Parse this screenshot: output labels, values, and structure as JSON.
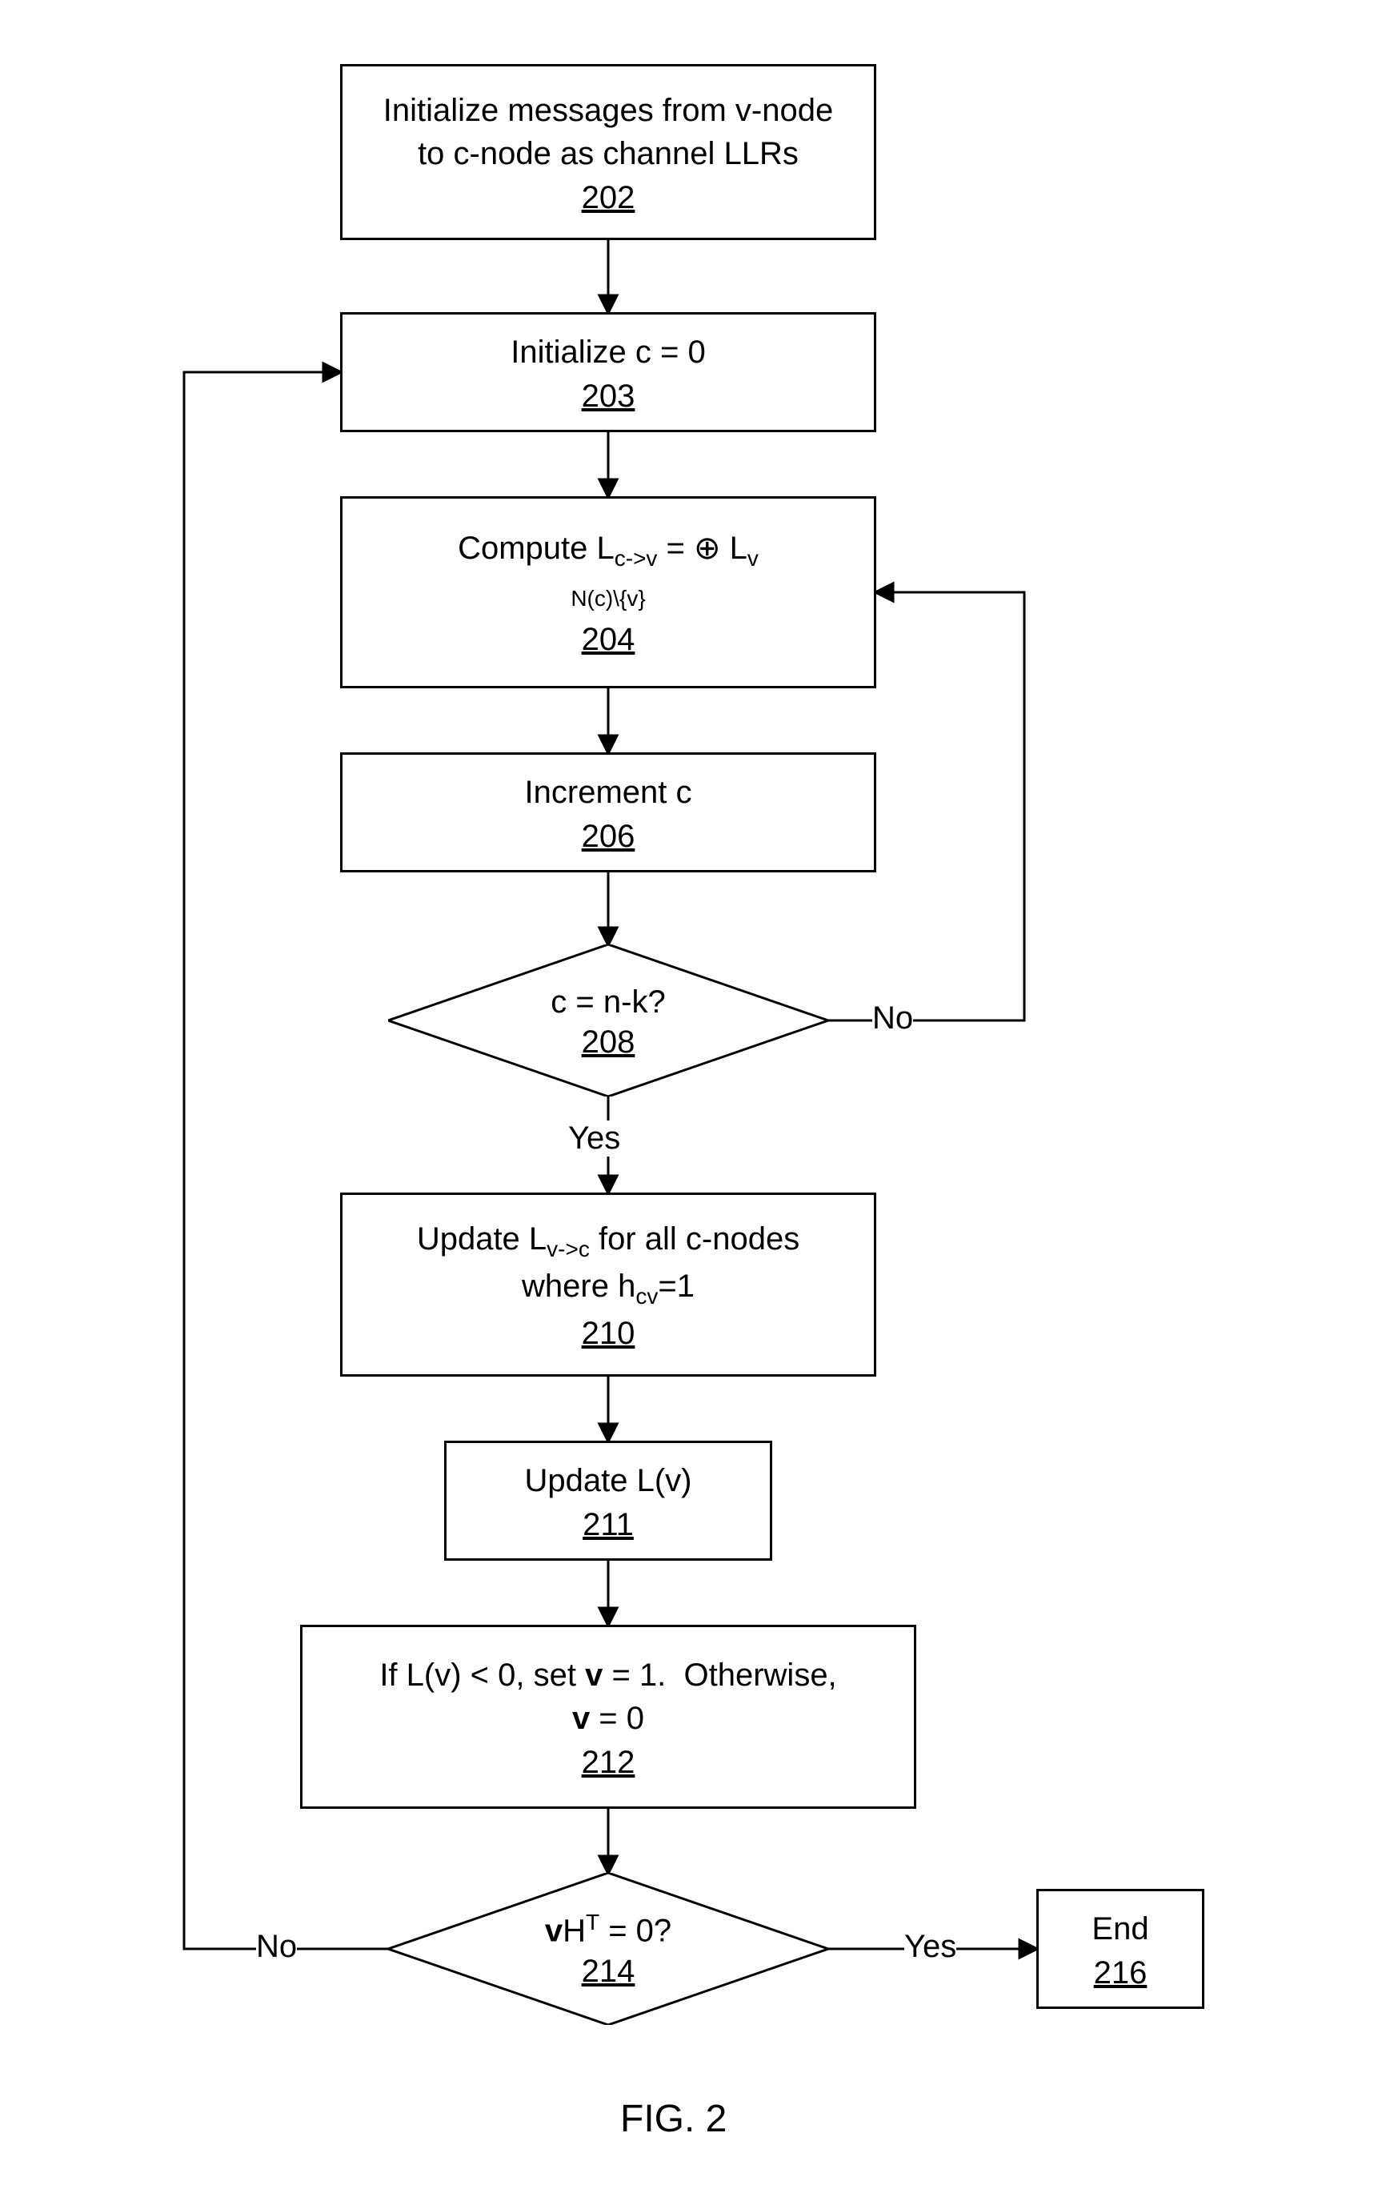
{
  "chart_data": {
    "type": "flowchart",
    "nodes": [
      {
        "id": "202",
        "shape": "rect",
        "text": "Initialize messages from v-node to c-node as channel LLRs"
      },
      {
        "id": "203",
        "shape": "rect",
        "text": "Initialize c = 0"
      },
      {
        "id": "204",
        "shape": "rect",
        "text": "Compute L_{c->v} = ⊕ over N(c)\\{v} of L_v"
      },
      {
        "id": "206",
        "shape": "rect",
        "text": "Increment c"
      },
      {
        "id": "208",
        "shape": "decision",
        "text": "c = n-k?"
      },
      {
        "id": "210",
        "shape": "rect",
        "text": "Update L_{v->c} for all c-nodes where h_{cv}=1"
      },
      {
        "id": "211",
        "shape": "rect",
        "text": "Update L(v)"
      },
      {
        "id": "212",
        "shape": "rect",
        "text": "If L(v) < 0, set v = 1.  Otherwise, v = 0"
      },
      {
        "id": "214",
        "shape": "decision",
        "text": "vH^T = 0?"
      },
      {
        "id": "216",
        "shape": "rect",
        "text": "End"
      }
    ],
    "edges": [
      {
        "from": "202",
        "to": "203"
      },
      {
        "from": "203",
        "to": "204"
      },
      {
        "from": "204",
        "to": "206"
      },
      {
        "from": "206",
        "to": "208"
      },
      {
        "from": "208",
        "to": "210",
        "label": "Yes"
      },
      {
        "from": "208",
        "to": "204",
        "label": "No"
      },
      {
        "from": "210",
        "to": "211"
      },
      {
        "from": "211",
        "to": "212"
      },
      {
        "from": "212",
        "to": "214"
      },
      {
        "from": "214",
        "to": "216",
        "label": "Yes"
      },
      {
        "from": "214",
        "to": "203",
        "label": "No"
      }
    ]
  },
  "nodes": {
    "n202": {
      "t": "Initialize messages from v-node<br>to c-node as channel LLRs",
      "ref": "202"
    },
    "n203": {
      "t": "Initialize c = 0",
      "ref": "203"
    },
    "n204": {
      "t": "Compute L<sub>c-&gt;v</sub> = ⊕ L<sub>v</sub><br><span style='font-size:28px'>N(c)\\{v}</span>",
      "ref": "204"
    },
    "n206": {
      "t": "Increment c",
      "ref": "206"
    },
    "n208": {
      "t": "c = n-k?",
      "ref": "208"
    },
    "n210": {
      "t": "Update L<sub>v-&gt;c</sub> for all c-nodes<br>where h<sub>cv</sub>=1",
      "ref": "210"
    },
    "n211": {
      "t": "Update L(v)",
      "ref": "211"
    },
    "n212": {
      "t": "If L(v) &lt; 0, set <span class='bold'>v</span> = 1.&nbsp;&nbsp;Otherwise,<br><span class='bold'>v</span> = 0",
      "ref": "212"
    },
    "n214": {
      "t": "<span class='bold'>v</span>H<sup>T</sup> = 0?",
      "ref": "214"
    },
    "n216": {
      "t": "End",
      "ref": "216"
    }
  },
  "labels": {
    "yes": "Yes",
    "no": "No",
    "fig": "FIG. 2"
  }
}
